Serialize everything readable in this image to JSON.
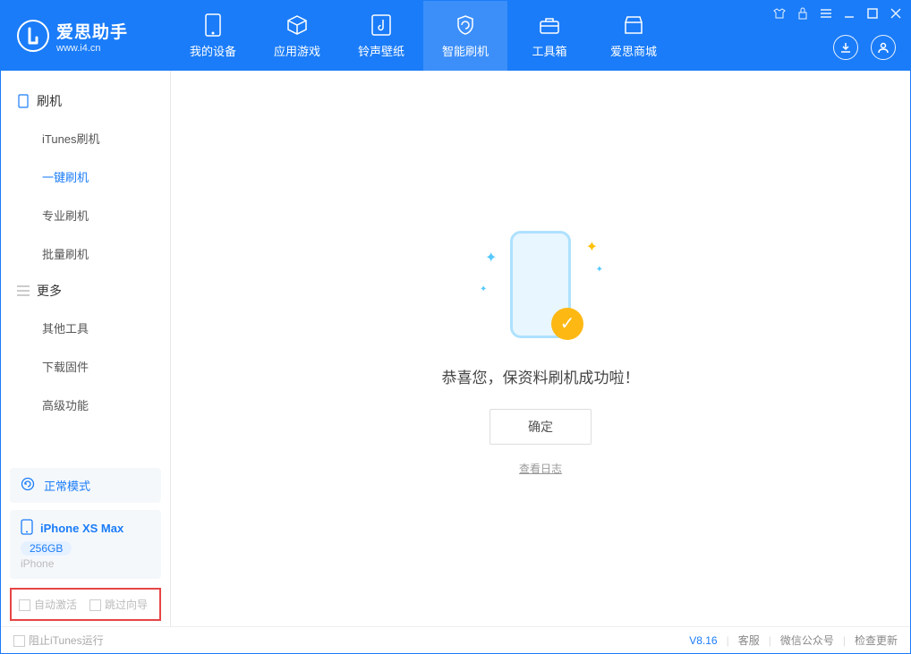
{
  "app": {
    "title": "爱思助手",
    "url": "www.i4.cn"
  },
  "tabs": [
    {
      "label": "我的设备"
    },
    {
      "label": "应用游戏"
    },
    {
      "label": "铃声壁纸"
    },
    {
      "label": "智能刷机"
    },
    {
      "label": "工具箱"
    },
    {
      "label": "爱思商城"
    }
  ],
  "sidebar": {
    "group1": {
      "title": "刷机",
      "items": [
        "iTunes刷机",
        "一键刷机",
        "专业刷机",
        "批量刷机"
      ]
    },
    "group2": {
      "title": "更多",
      "items": [
        "其他工具",
        "下载固件",
        "高级功能"
      ]
    }
  },
  "mode": {
    "label": "正常模式"
  },
  "device": {
    "name": "iPhone XS Max",
    "storage": "256GB",
    "type": "iPhone"
  },
  "options": {
    "auto_activate": "自动激活",
    "skip_guide": "跳过向导"
  },
  "main": {
    "success_msg": "恭喜您，保资料刷机成功啦！",
    "ok": "确定",
    "view_log": "查看日志"
  },
  "footer": {
    "block_itunes": "阻止iTunes运行",
    "version": "V8.16",
    "links": [
      "客服",
      "微信公众号",
      "检查更新"
    ]
  }
}
